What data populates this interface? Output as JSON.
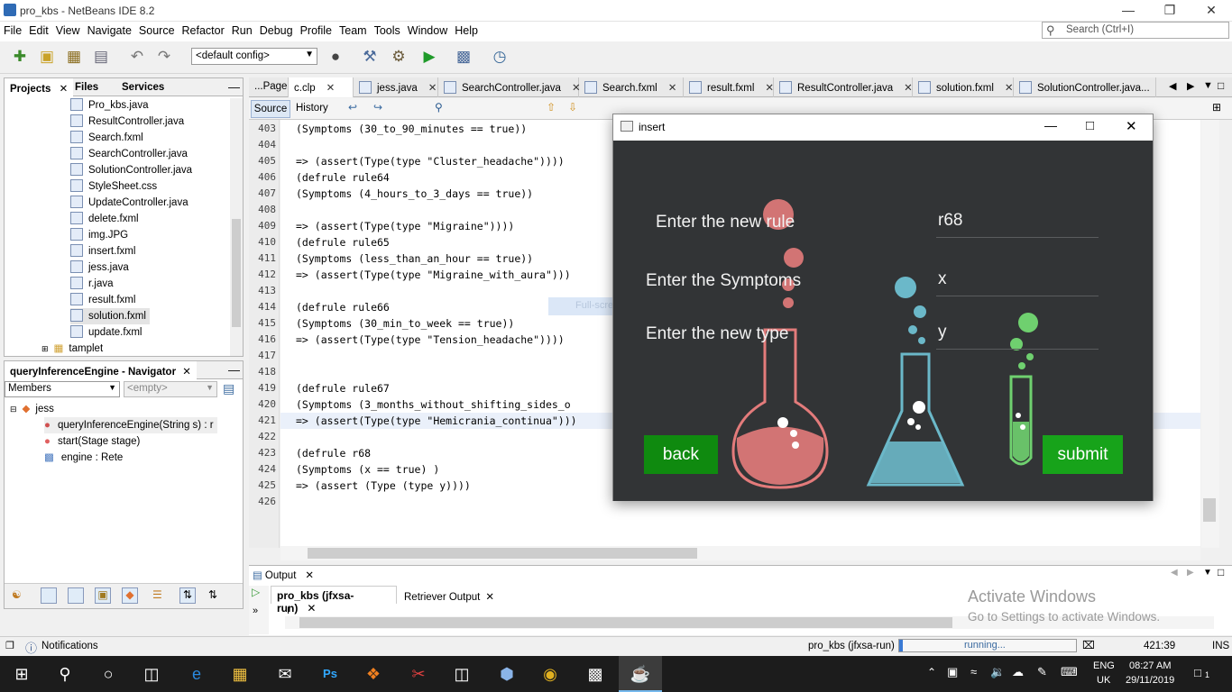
{
  "window": {
    "title": "pro_kbs - NetBeans IDE 8.2"
  },
  "menu": [
    "File",
    "Edit",
    "View",
    "Navigate",
    "Source",
    "Refactor",
    "Run",
    "Debug",
    "Profile",
    "Team",
    "Tools",
    "Window",
    "Help"
  ],
  "search": {
    "placeholder": "Search (Ctrl+I)"
  },
  "toolbar": {
    "config": "<default config>"
  },
  "projects": {
    "tabs": [
      "Projects",
      "Files",
      "Services"
    ],
    "files": [
      "Pro_kbs.java",
      "ResultController.java",
      "Search.fxml",
      "SearchController.java",
      "SolutionController.java",
      "StyleSheet.css",
      "UpdateController.java",
      "delete.fxml",
      "img.JPG",
      "insert.fxml",
      "jess.java",
      "r.java",
      "result.fxml",
      "solution.fxml",
      "update.fxml"
    ],
    "folder": "tamplet"
  },
  "navigator": {
    "title": "queryInferenceEngine - Navigator",
    "members": "Members",
    "filter": "<empty>",
    "root": "jess",
    "items": [
      "queryInferenceEngine(String s) : r",
      "start(Stage stage)",
      "engine : Rete"
    ]
  },
  "editor": {
    "tabs": [
      "...Page",
      "c.clp",
      "jess.java",
      "SearchController.java",
      "Search.fxml",
      "result.fxml",
      "ResultController.java",
      "solution.fxml",
      "SolutionController.java..."
    ],
    "source_tab": "Source",
    "history_tab": "History",
    "lines": [
      {
        "n": "403",
        "t": "(Symptoms (30_to_90_minutes == true))"
      },
      {
        "n": "404",
        "t": ""
      },
      {
        "n": "405",
        "t": "=> (assert(Type(type \"Cluster_headache\"))))"
      },
      {
        "n": "406",
        "t": "(defrule rule64"
      },
      {
        "n": "407",
        "t": "(Symptoms (4_hours_to_3_days == true))"
      },
      {
        "n": "408",
        "t": ""
      },
      {
        "n": "409",
        "t": "=> (assert(Type(type \"Migraine\"))))"
      },
      {
        "n": "410",
        "t": "(defrule rule65"
      },
      {
        "n": "411",
        "t": "(Symptoms (less_than_an_hour == true))"
      },
      {
        "n": "412",
        "t": "=> (assert(Type(type \"Migraine_with_aura\")))"
      },
      {
        "n": "413",
        "t": ""
      },
      {
        "n": "414",
        "t": "(defrule rule66"
      },
      {
        "n": "415",
        "t": "(Symptoms (30_min_to_week == true))"
      },
      {
        "n": "416",
        "t": "=> (assert(Type(type \"Tension_headache\"))))"
      },
      {
        "n": "417",
        "t": ""
      },
      {
        "n": "418",
        "t": ""
      },
      {
        "n": "419",
        "t": "(defrule rule67"
      },
      {
        "n": "420",
        "t": "(Symptoms (3_months_without_shifting_sides_o"
      },
      {
        "n": "421",
        "t": "=> (assert(Type(type \"Hemicrania_continua\")))"
      },
      {
        "n": "422",
        "t": ""
      },
      {
        "n": "423",
        "t": "(defrule r68"
      },
      {
        "n": "424",
        "t": "(Symptoms (x == true) )"
      },
      {
        "n": "425",
        "t": "=> (assert (Type (type y))))"
      },
      {
        "n": "426",
        "t": ""
      }
    ],
    "snip_text": "Full-screen Snip"
  },
  "dialog": {
    "title": "insert",
    "rule_label": "Enter the new rule",
    "rule_value": "r68",
    "symptoms_label": "Enter the Symptoms",
    "symptoms_value": "x",
    "type_label": "Enter the new type",
    "type_value": "y",
    "back": "back",
    "submit": "submit"
  },
  "output": {
    "title": "Output",
    "tabs": [
      "pro_kbs (jfxsa-run)",
      "Retriever Output"
    ],
    "cursor": "I"
  },
  "watermark": {
    "line1": "Activate Windows",
    "line2": "Go to Settings to activate Windows."
  },
  "status": {
    "notifications": "Notifications",
    "task": "pro_kbs (jfxsa-run)",
    "progress": "running...",
    "position": "421:39",
    "mode": "INS"
  },
  "taskbar": {
    "lang1": "ENG",
    "lang2": "UK",
    "time": "08:27 AM",
    "date": "29/11/2019",
    "notif_count": "1"
  }
}
